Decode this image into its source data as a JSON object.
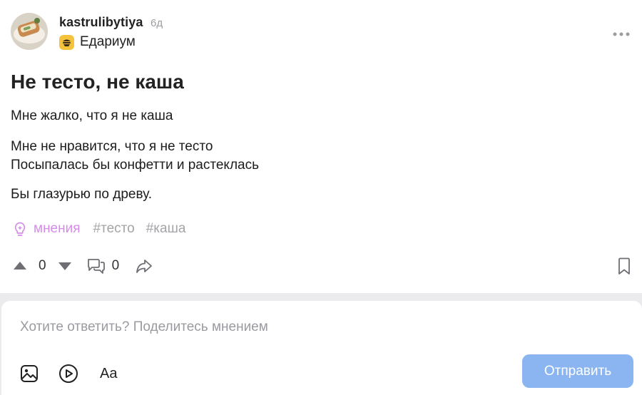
{
  "post": {
    "author": "kastrulibytiya",
    "time_ago": "6д",
    "community": "Едариум",
    "title": "Не тесто, не каша",
    "paragraphs": [
      "Мне жалко, что я не каша",
      "Мне не нравится, что я не тесто",
      "Посыпалась бы конфетти и растеклась",
      "Бы глазурью по древу."
    ],
    "tags": {
      "ideas_label": "мнения",
      "items": [
        "#тесто",
        "#каша"
      ]
    },
    "votes": "0",
    "comments": "0"
  },
  "reply": {
    "placeholder": "Хотите ответить? Поделитесь мнением",
    "format_label": "Aa",
    "send_label": "Отправить"
  },
  "icons": {
    "more": "more-horizontal-icon",
    "upvote": "triangle-up-icon",
    "downvote": "triangle-down-icon",
    "comments": "comments-icon",
    "share": "share-arrow-icon",
    "bookmark": "bookmark-icon",
    "image": "image-icon",
    "video": "play-icon",
    "ideas": "lightbulb-icon"
  },
  "colors": {
    "accent_tag": "#d58ce8",
    "send_button": "#8ab5f1",
    "community_badge": "#f5c33b",
    "muted": "#9c9ca1"
  }
}
